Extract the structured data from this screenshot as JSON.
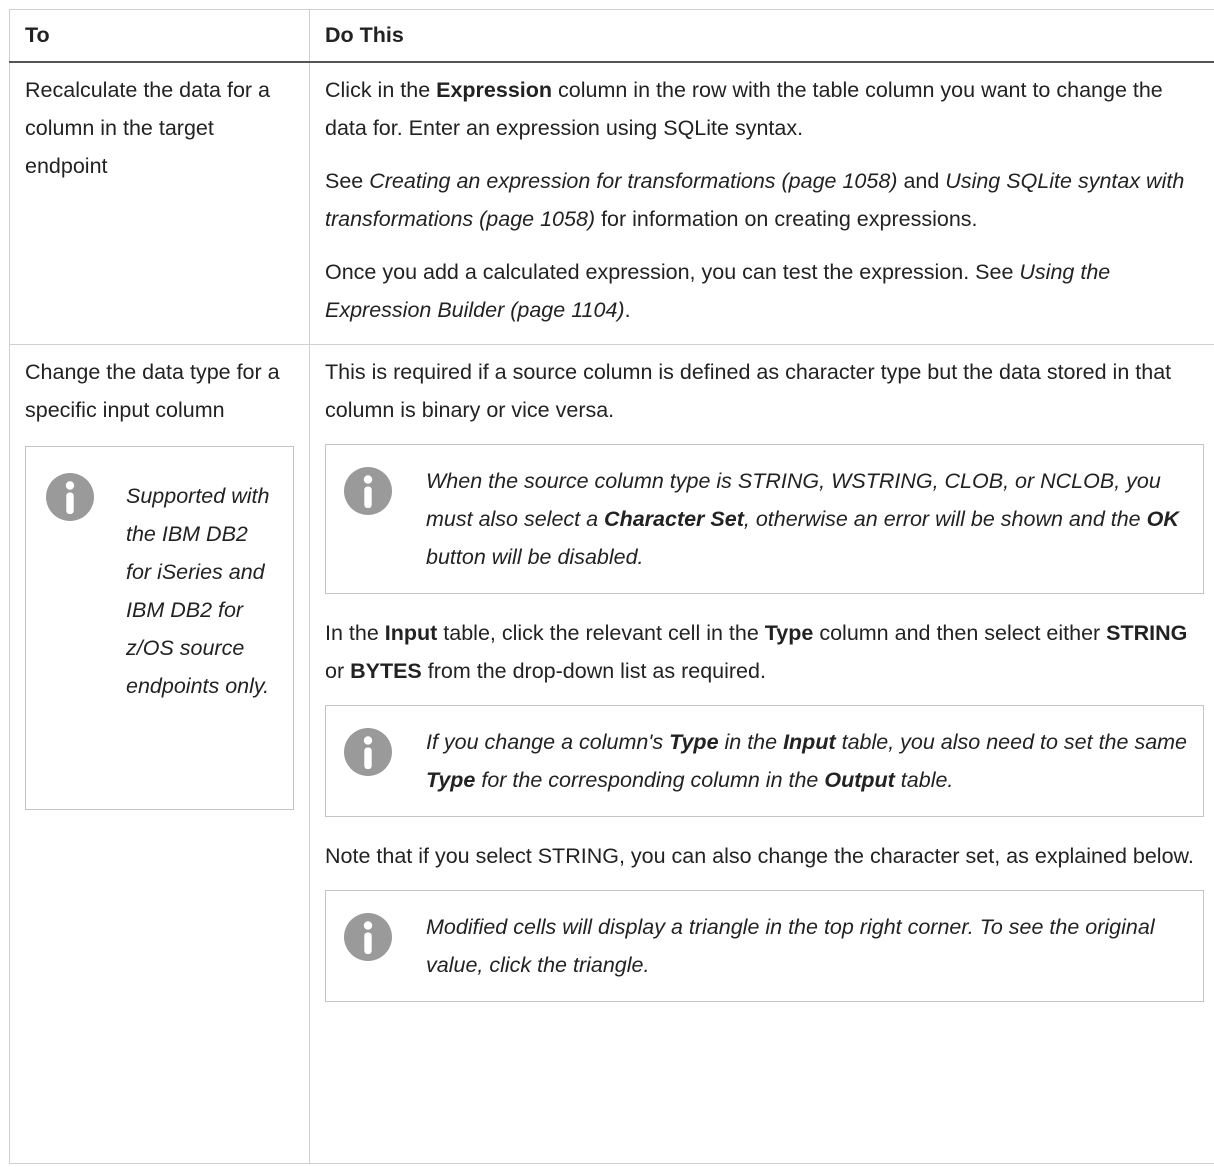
{
  "table": {
    "headers": [
      "To",
      "Do This"
    ],
    "row1": {
      "to": "Recalculate the data for a column in the target endpoint",
      "p1": {
        "t1": "Click in the ",
        "b1": "Expression",
        "t2": " column in the row with the table column you want to change the data for. Enter an expression using SQLite syntax."
      },
      "p2": {
        "t1": "See ",
        "i1": "Creating an expression for transformations (page 1058)",
        "t2": " and ",
        "i2": "Using SQLite syntax with transformations (page 1058)",
        "t3": " for information on creating expressions."
      },
      "p3": {
        "t1": "Once you add a calculated expression, you can test the expression. See ",
        "i1": "Using the Expression Builder (page 1104)",
        "t2": "."
      }
    },
    "row2": {
      "to": "Change the data type for a specific input column",
      "side_note": "Supported with the IBM DB2 for iSeries and IBM DB2 for z/OS source endpoints only.",
      "p1": "This is required if a source column is defined as character type but the data stored in that column is binary or vice versa.",
      "note1": {
        "t1": "When the source column type is STRING, WSTRING, CLOB, or NCLOB, you must also select a ",
        "b1": "Character Set",
        "t2": ", otherwise an error will be shown and the ",
        "b2": "OK",
        "t3": " button will be disabled."
      },
      "p2": {
        "t1": "In the ",
        "b1": "Input",
        "t2": " table, click the relevant cell in the ",
        "b2": "Type",
        "t3": " column and then select either ",
        "b3": "STRING",
        "t4": " or ",
        "b4": "BYTES",
        "t5": " from the drop-down list as required."
      },
      "note2": {
        "t1": "If you change a column's ",
        "b1": "Type",
        "t2": " in the ",
        "b2": "Input",
        "t3": " table, you also need to set the same ",
        "b3": "Type",
        "t4": " for the corresponding column in the ",
        "b4": "Output",
        "t5": " table."
      },
      "p3": "Note that if you select STRING, you can also change the character set, as explained below.",
      "note3": "Modified cells will display a triangle in the top right corner. To see the original value, click the triangle."
    }
  },
  "icons": {
    "info": "info-icon"
  },
  "colors": {
    "icon": "#9a9a9a",
    "border": "#d0d0d0",
    "header_rule": "#555555"
  }
}
